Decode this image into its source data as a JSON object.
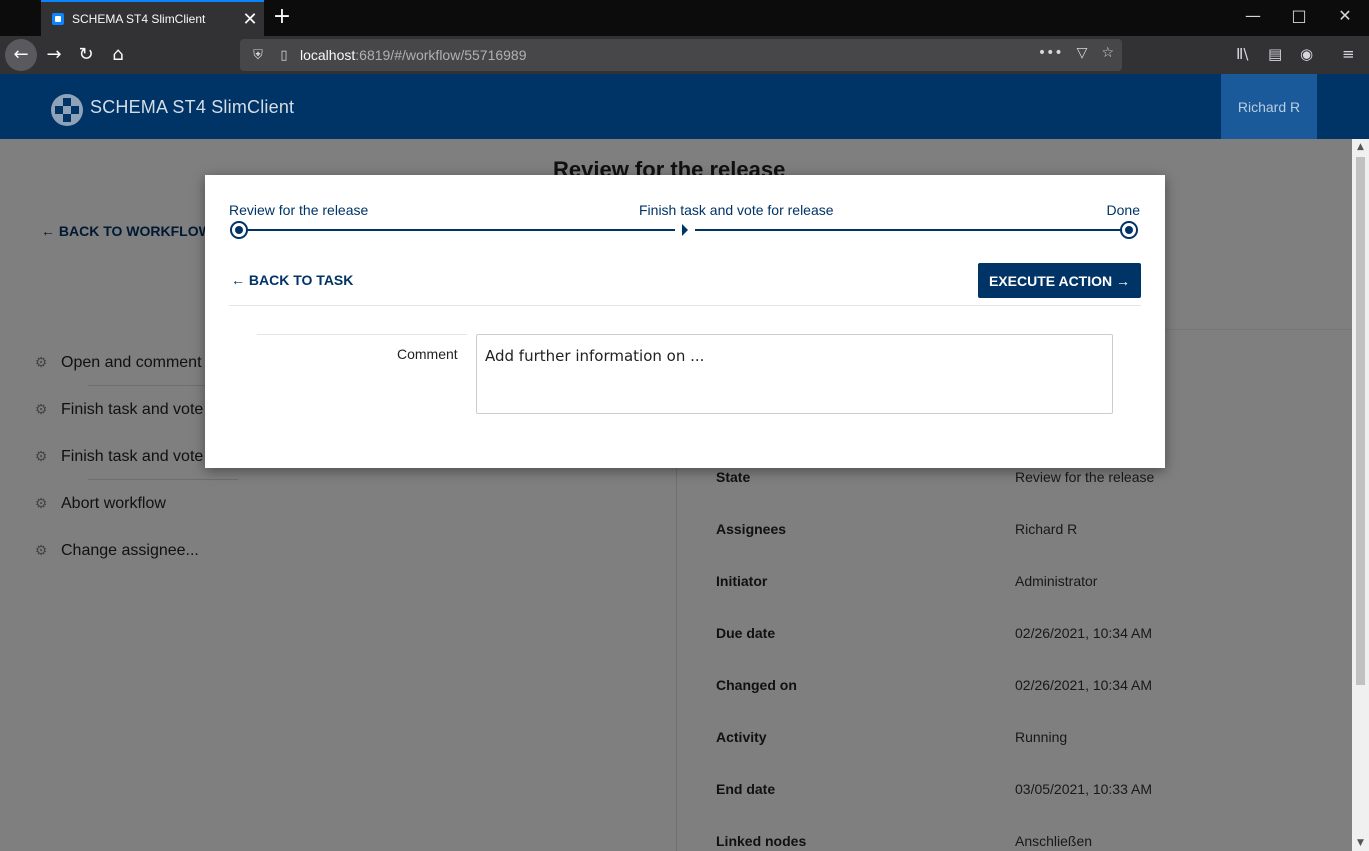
{
  "browser": {
    "tab_title": "SCHEMA ST4 SlimClient",
    "url_host": "localhost",
    "url_rest": ":6819/#/workflow/55716989",
    "new_tab": "+",
    "close": "✕"
  },
  "app": {
    "logo_text": "SCHEMA ST4 SlimClient",
    "user": "Richard R"
  },
  "page": {
    "title": "Review for the release",
    "back_label": "BACK TO WORKFLOW T",
    "actions": [
      {
        "label": "Open and comment"
      },
      {
        "label": "Finish task and vote"
      },
      {
        "label": "Finish task and vote"
      },
      {
        "label": "Abort workflow"
      },
      {
        "label": "Change assignee..."
      }
    ],
    "properties": [
      {
        "label": "State",
        "value": "Review for the release"
      },
      {
        "label": "Assignees",
        "value": "Richard R"
      },
      {
        "label": "Initiator",
        "value": "Administrator"
      },
      {
        "label": "Due date",
        "value": "02/26/2021, 10:34 AM"
      },
      {
        "label": "Changed on",
        "value": "02/26/2021, 10:34 AM"
      },
      {
        "label": "Activity",
        "value": "Running"
      },
      {
        "label": "End date",
        "value": "03/05/2021, 10:33 AM"
      },
      {
        "label": "Linked nodes",
        "value": "Anschließen"
      }
    ]
  },
  "modal": {
    "steps": {
      "start": "Review for the release",
      "middle": "Finish task and vote for release",
      "end": "Done"
    },
    "back_label": "BACK TO TASK",
    "execute_label": "EXECUTE ACTION",
    "comment_label": "Comment",
    "comment_placeholder": "Add further information on ..."
  }
}
